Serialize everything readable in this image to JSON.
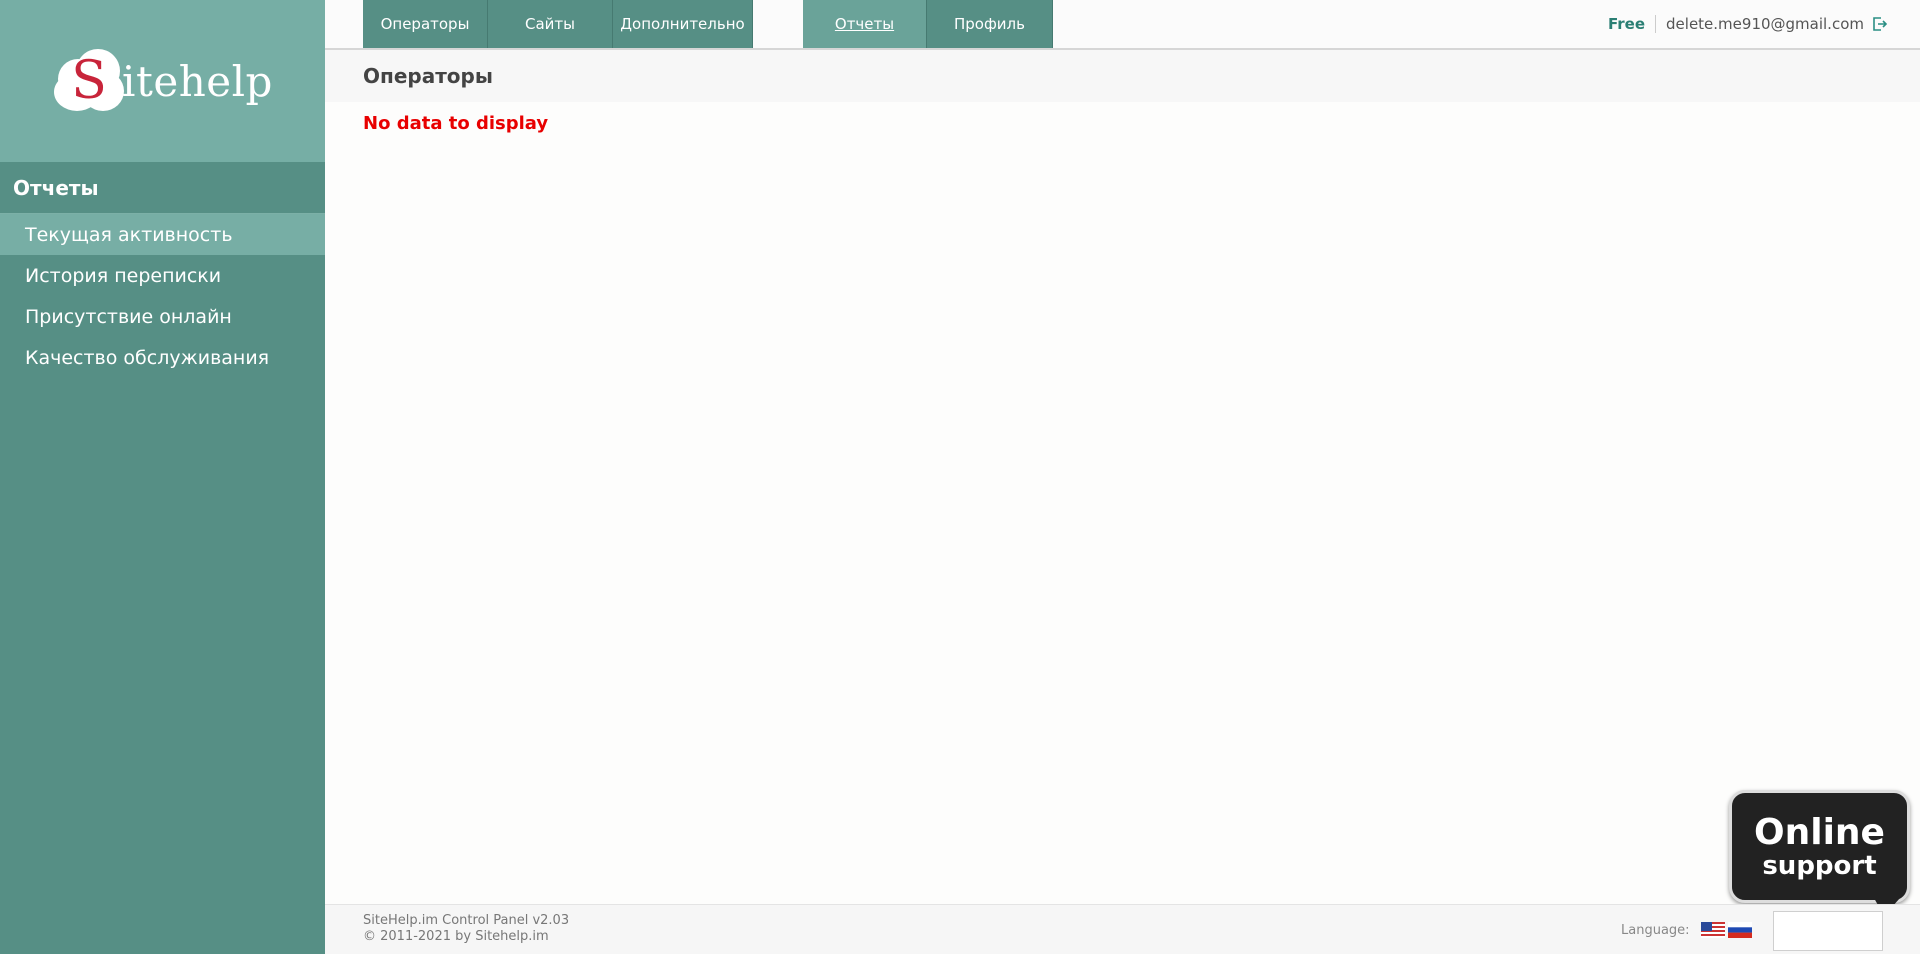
{
  "brand": {
    "logo_letter": "S",
    "logo_text": "itehelp"
  },
  "sidebar": {
    "section_title": "Отчеты",
    "items": [
      {
        "label": "Текущая активность",
        "active": true
      },
      {
        "label": "История переписки",
        "active": false
      },
      {
        "label": "Присутствие онлайн",
        "active": false
      },
      {
        "label": "Качество обслуживания",
        "active": false
      }
    ]
  },
  "nav": {
    "tabs_left": [
      "Операторы",
      "Сайты",
      "Дополнительно"
    ],
    "tabs_right": [
      "Отчеты",
      "Профиль"
    ],
    "active_tab": "Отчеты"
  },
  "account": {
    "plan": "Free",
    "email": "delete.me910@gmail.com",
    "logout_icon": "logout-icon"
  },
  "main": {
    "page_title": "Операторы",
    "empty_message": "No data to display"
  },
  "footer": {
    "line1": "SiteHelp.im Control Panel v2.03",
    "line2": "© 2011-2021 by Sitehelp.im",
    "language_label": "Language:"
  },
  "support_widget": {
    "line1": "Online",
    "line2": "support"
  },
  "colors": {
    "sidebar": "#568f85",
    "accent": "#2b7f74",
    "error": "#e80000"
  }
}
